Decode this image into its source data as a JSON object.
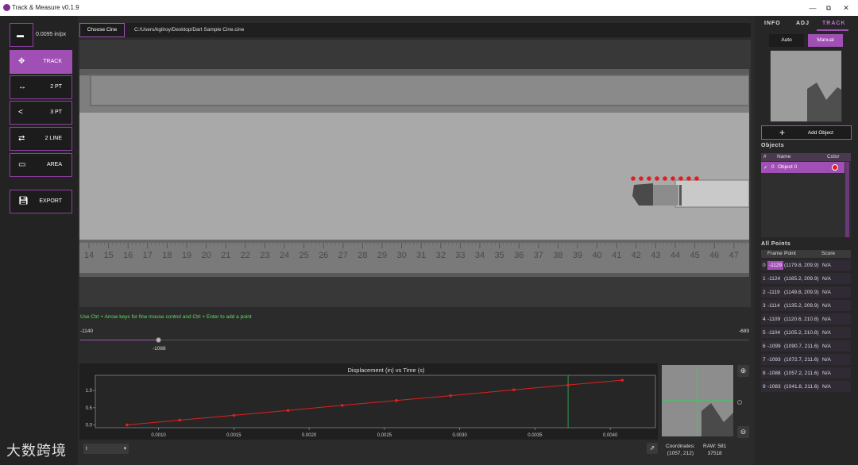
{
  "app": {
    "title": "Track & Measure v0.1.9"
  },
  "window": {
    "minimize": "—",
    "restore": "⧉",
    "close": "✕"
  },
  "left": {
    "scale_value": "0.0095 in/px",
    "buttons": [
      {
        "label": "TRACK",
        "icon": "crosshair-icon"
      },
      {
        "label": "2 PT",
        "icon": "two-point-icon"
      },
      {
        "label": "3 PT",
        "icon": "angle-icon"
      },
      {
        "label": "2 LINE",
        "icon": "two-line-icon"
      },
      {
        "label": "AREA",
        "icon": "area-icon"
      }
    ],
    "export_label": "EXPORT"
  },
  "file": {
    "choose_label": "Choose Cine",
    "path": "C:/Users/kgilroy/Desktop/Dart Sample Cine.cine"
  },
  "ruler": {
    "labels": [
      "14",
      "15",
      "16",
      "17",
      "18",
      "19",
      "20",
      "21",
      "22",
      "23",
      "24",
      "25",
      "26",
      "27",
      "28",
      "29",
      "30",
      "31",
      "32",
      "33",
      "34",
      "35",
      "36",
      "37",
      "38",
      "39",
      "40",
      "41",
      "42",
      "43",
      "44",
      "45",
      "46",
      "47"
    ]
  },
  "hint": "Use Ctrl + Arrow keys for fine mouse control and Ctrl + Enter to add a point",
  "slider": {
    "min": "-1140",
    "max": "-689",
    "current": "-1088"
  },
  "plot_title": "Displacement (in) vs Time (s)",
  "dropdown_value": "t",
  "coords": {
    "label": "Coordinates:",
    "value": "(1057, 212)"
  },
  "raw": {
    "label": "RAW: 581",
    "value": "37518"
  },
  "watermark": "大数跨境",
  "tabs": [
    "INFO",
    "ADJ",
    "TRACK"
  ],
  "mode": {
    "auto": "Auto",
    "manual": "Manual"
  },
  "add_object_label": "Add Object",
  "objects": {
    "title": "Objects",
    "headers": {
      "num": "#",
      "name": "Name",
      "color": "Color"
    },
    "rows": [
      {
        "check": "✓",
        "num": "0",
        "name": "Object 0"
      }
    ]
  },
  "all_points": {
    "title": "All Points",
    "headers": {
      "frame": "Frame",
      "point": "Point",
      "score": "Score"
    },
    "rows": [
      {
        "idx": "0",
        "frame": "-1129",
        "point": "(1179.8, 209.9)",
        "score": "N/A"
      },
      {
        "idx": "1",
        "frame": "-1124",
        "point": "(1165.2, 209.9)",
        "score": "N/A"
      },
      {
        "idx": "2",
        "frame": "-1119",
        "point": "(1149.8, 209.9)",
        "score": "N/A"
      },
      {
        "idx": "3",
        "frame": "-1114",
        "point": "(1135.2, 209.9)",
        "score": "N/A"
      },
      {
        "idx": "4",
        "frame": "-1109",
        "point": "(1120.6, 210.8)",
        "score": "N/A"
      },
      {
        "idx": "5",
        "frame": "-1104",
        "point": "(1105.2, 210.8)",
        "score": "N/A"
      },
      {
        "idx": "6",
        "frame": "-1099",
        "point": "(1090.7, 211.6)",
        "score": "N/A"
      },
      {
        "idx": "7",
        "frame": "-1093",
        "point": "(1072.7, 211.6)",
        "score": "N/A"
      },
      {
        "idx": "8",
        "frame": "-1088",
        "point": "(1057.2, 211.6)",
        "score": "N/A"
      },
      {
        "idx": "9",
        "frame": "-1083",
        "point": "(1041.8, 211.6)",
        "score": "N/A"
      }
    ]
  },
  "chart_data": {
    "type": "line",
    "title": "Displacement (in) vs Time (s)",
    "xlabel": "",
    "ylabel": "",
    "xlim": [
      0.00058,
      0.0043
    ],
    "ylim": [
      -0.08,
      1.44
    ],
    "xticks": [
      "0.0010",
      "0.0015",
      "0.0020",
      "0.0025",
      "0.0030",
      "0.0035",
      "0.0040"
    ],
    "xtick_values": [
      0.001,
      0.0015,
      0.002,
      0.0025,
      0.003,
      0.0035,
      0.004
    ],
    "yticks": [
      "0.0",
      "0.5",
      "1.0"
    ],
    "ytick_values": [
      0,
      0.5,
      1.0
    ],
    "cursor_x": 0.00372,
    "series": [
      {
        "color": "#e02020",
        "x": [
          0.00079,
          0.00114,
          0.0015,
          0.00186,
          0.00222,
          0.00258,
          0.00294,
          0.00336,
          0.00372,
          0.00408
        ],
        "y": [
          0.0,
          0.14,
          0.28,
          0.42,
          0.57,
          0.71,
          0.85,
          1.02,
          1.16,
          1.3
        ]
      }
    ]
  },
  "track_points": {
    "count": 9,
    "color": "#e02020"
  }
}
